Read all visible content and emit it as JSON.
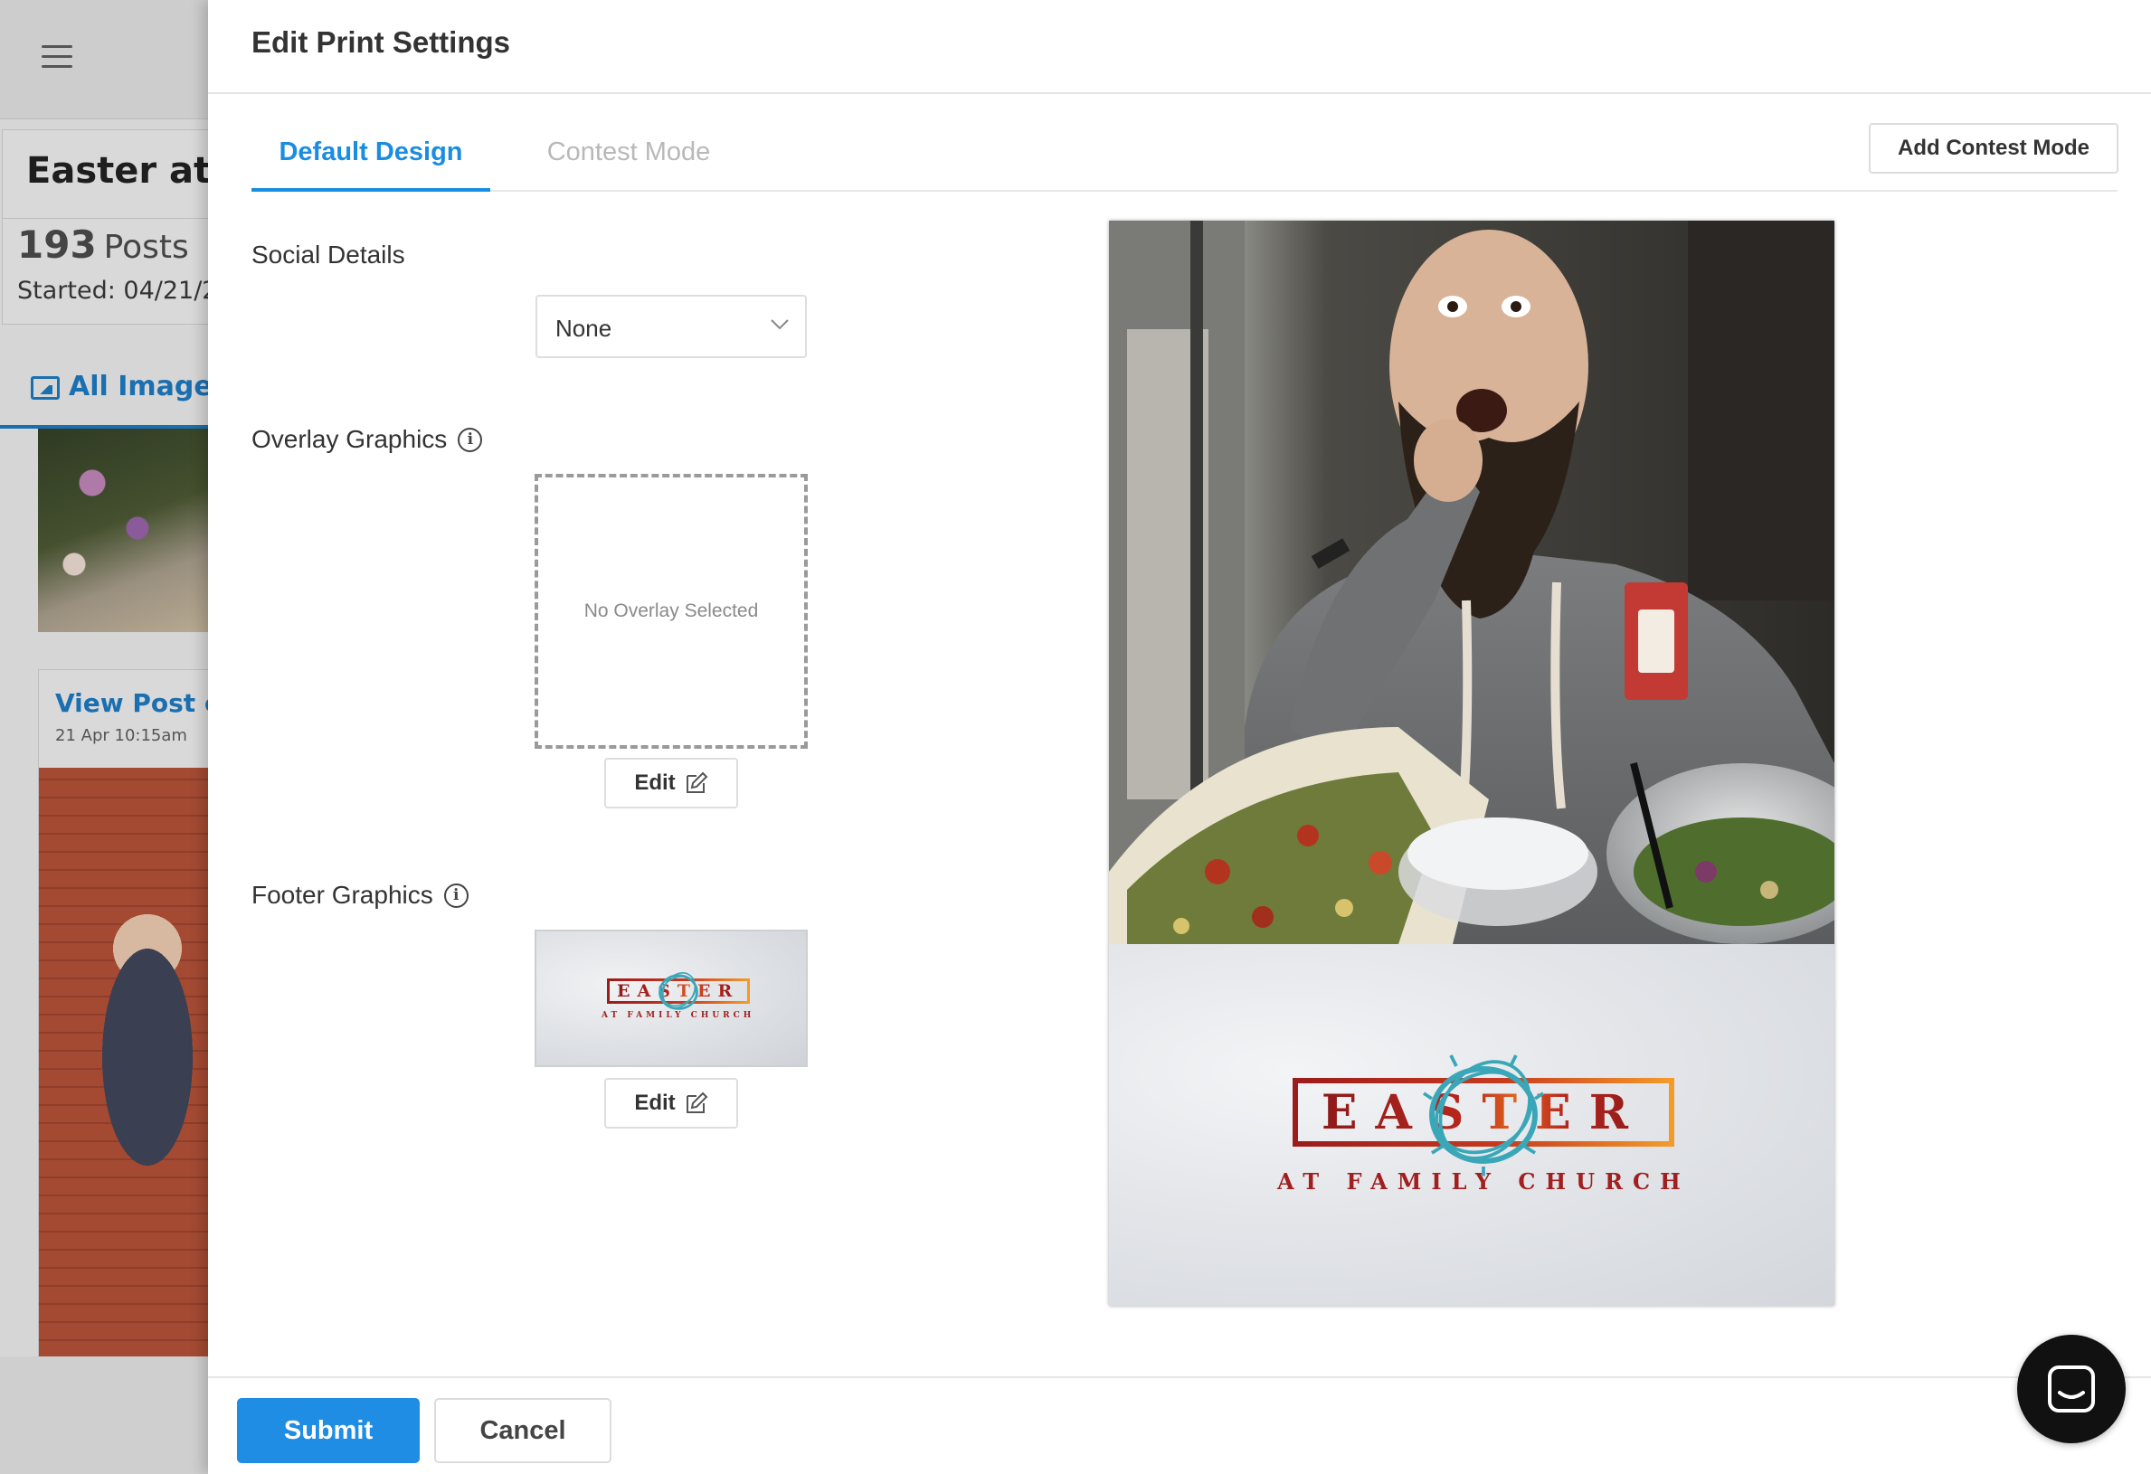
{
  "background": {
    "campaign_title": "Easter at F",
    "post_count": "193",
    "post_count_label": "Posts",
    "started": "Started: 04/21/2",
    "tab_label": "All Images",
    "post_link": "View Post on",
    "post_time": "21 Apr 10:15am"
  },
  "modal": {
    "title": "Edit Print Settings",
    "tabs": [
      {
        "label": "Default Design",
        "active": true
      },
      {
        "label": "Contest Mode",
        "active": false
      }
    ],
    "add_contest_label": "Add Contest Mode",
    "social_details": {
      "label": "Social Details",
      "selected": "None"
    },
    "overlay": {
      "label": "Overlay Graphics",
      "placeholder": "No Overlay Selected",
      "edit_label": "Edit"
    },
    "footer_graphics": {
      "label": "Footer Graphics",
      "edit_label": "Edit"
    },
    "footer_artwork": {
      "word": "EASTER",
      "subtitle": "AT FAMILY CHURCH"
    },
    "submit_label": "Submit",
    "cancel_label": "Cancel"
  },
  "icons": {
    "menu": "hamburger-icon",
    "info": "info-icon",
    "edit": "edit-pencil-icon",
    "chevron": "chevron-down-icon",
    "chat": "chat-icon",
    "images": "images-icon"
  },
  "colors": {
    "accent": "#1f8de4",
    "tab_active": "#1a8de0",
    "easter_red": "#a11f1f",
    "easter_orange": "#f39a2a",
    "crown_teal": "#3aa7b8"
  }
}
